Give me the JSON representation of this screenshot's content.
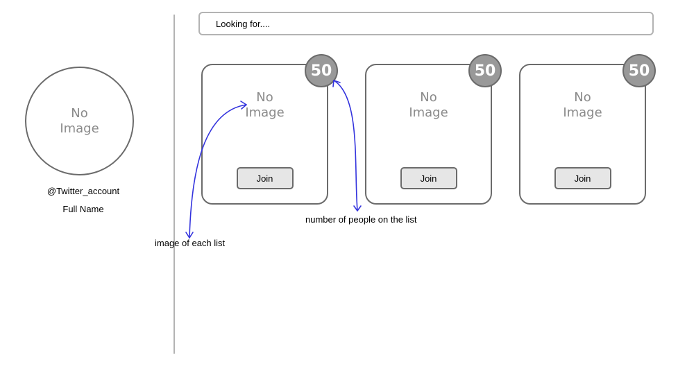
{
  "profile": {
    "avatar_text": "No\nImage",
    "twitter_account": "@Twitter_account",
    "full_name": "Full Name"
  },
  "search": {
    "placeholder": "Looking for...."
  },
  "lists": [
    {
      "image_text": "No\nImage",
      "count": "50",
      "join_label": "Join"
    },
    {
      "image_text": "No\nImage",
      "count": "50",
      "join_label": "Join"
    },
    {
      "image_text": "No\nImage",
      "count": "50",
      "join_label": "Join"
    }
  ],
  "annotations": {
    "image_note": "image of each list",
    "count_note": "number of people on the list"
  },
  "colors": {
    "arrow": "#3333dd",
    "badge": "#999999",
    "border": "#6b6b6b",
    "no_image_text": "#8a8a8a",
    "button_fill": "#e6e6e6"
  }
}
